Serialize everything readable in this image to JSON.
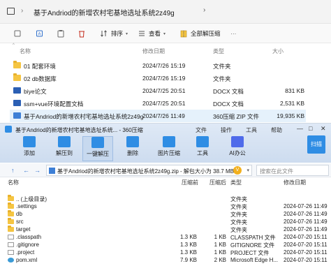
{
  "explorer": {
    "path": "基于Andriod的新增农村宅基地选址系统2z49g",
    "toolbar": {
      "sort_label": "排序",
      "view_label": "查看",
      "extract_all_label": "全部解压缩",
      "more_label": "···"
    },
    "columns": {
      "name": "名称",
      "modified": "修改日期",
      "type": "类型",
      "size": "大小"
    },
    "rows": [
      {
        "name": "01 配套环境",
        "modified": "2024/7/26 15:19",
        "type": "文件夹",
        "size": "",
        "icon": "folder-icon"
      },
      {
        "name": "02 db数据库",
        "modified": "2024/7/26 15:19",
        "type": "文件夹",
        "size": "",
        "icon": "folder-icon"
      },
      {
        "name": "biye论文",
        "modified": "2024/7/25 20:51",
        "type": "DOCX 文档",
        "size": "831 KB",
        "icon": "docx-icon"
      },
      {
        "name": "ssm+vue环境配置文档",
        "modified": "2024/7/25 20:51",
        "type": "DOCX 文档",
        "size": "2,531 KB",
        "icon": "docx-icon"
      },
      {
        "name": "基于Andriod的新增农村宅基地选址系统2z49g",
        "modified": "2024/7/26 11:49",
        "type": "360压缩 ZIP 文件",
        "size": "19,935 KB",
        "icon": "zip-icon"
      }
    ]
  },
  "zip": {
    "title": "基于Andriod的新增农村宅基地选址系统...  - 360压缩",
    "menu": [
      "文件",
      "操作",
      "工具",
      "帮助"
    ],
    "ribbon": [
      "添加",
      "解压到",
      "一键解压",
      "删除",
      "图片压缩",
      "工具",
      "AI办公"
    ],
    "scan_label": "扫描",
    "address": "基于Andriod的新增农村宅基地选址系统2z49g.zip - 解包大小为 38.7 MB",
    "search_placeholder": "搜索在此文件",
    "columns": {
      "name": "名称",
      "compressed": "压缩前",
      "size": "压缩后",
      "type": "类型",
      "modified": "修改日期"
    },
    "rows": [
      {
        "name": ".. (上级目录)",
        "compressed": "",
        "size": "",
        "type": "文件夹",
        "modified": ""
      },
      {
        "name": ".settings",
        "compressed": "",
        "size": "",
        "type": "文件夹",
        "modified": "2024-07-26 11:49"
      },
      {
        "name": "db",
        "compressed": "",
        "size": "",
        "type": "文件夹",
        "modified": "2024-07-26 11:49"
      },
      {
        "name": "src",
        "compressed": "",
        "size": "",
        "type": "文件夹",
        "modified": "2024-07-26 11:49"
      },
      {
        "name": "target",
        "compressed": "",
        "size": "",
        "type": "文件夹",
        "modified": "2024-07-26 11:49"
      },
      {
        "name": ".classpath",
        "compressed": "1.3 KB",
        "size": "1 KB",
        "type": "CLASSPATH 文件",
        "modified": "2024-07-20 15:11"
      },
      {
        "name": ".gitignore",
        "compressed": "1.3 KB",
        "size": "1 KB",
        "type": "GITIGNORE 文件",
        "modified": "2024-07-20 15:11"
      },
      {
        "name": ".project",
        "compressed": "1.3 KB",
        "size": "1 KB",
        "type": "PROJECT 文件",
        "modified": "2024-07-20 15:11"
      },
      {
        "name": "pom.xml",
        "compressed": "7.9 KB",
        "size": "2 KB",
        "type": "Microsoft Edge H...",
        "modified": "2024-07-20 15:11"
      }
    ]
  }
}
